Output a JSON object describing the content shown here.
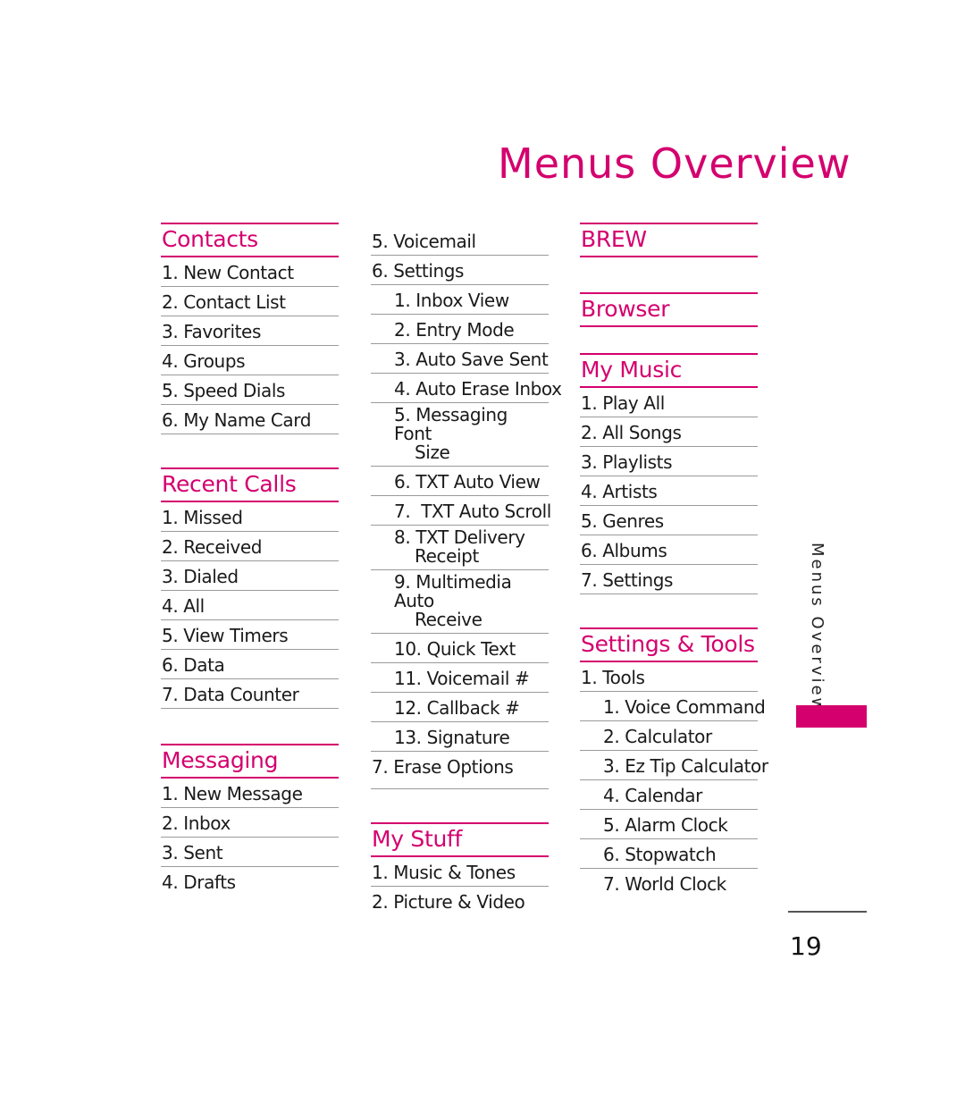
{
  "page": {
    "title": "Menus Overview",
    "side_tab_label": "Menus Overview",
    "page_number": "19",
    "accent_color": "#d4006e"
  },
  "columns": [
    {
      "sections": [
        {
          "heading": "Contacts",
          "items": [
            {
              "label": "1. New Contact"
            },
            {
              "label": "2. Contact List"
            },
            {
              "label": "3. Favorites"
            },
            {
              "label": "4. Groups"
            },
            {
              "label": "5. Speed Dials"
            },
            {
              "label": "6. My Name Card"
            }
          ]
        },
        {
          "heading": "Recent Calls",
          "items": [
            {
              "label": "1. Missed"
            },
            {
              "label": "2. Received"
            },
            {
              "label": "3. Dialed"
            },
            {
              "label": "4. All"
            },
            {
              "label": "5. View Timers"
            },
            {
              "label": "6. Data"
            },
            {
              "label": "7. Data Counter"
            }
          ]
        },
        {
          "heading": "Messaging",
          "items": [
            {
              "label": "1. New Message"
            },
            {
              "label": "2. Inbox"
            },
            {
              "label": "3. Sent"
            },
            {
              "label": "4. Drafts"
            }
          ]
        }
      ]
    },
    {
      "sections": [
        {
          "heading": null,
          "items": [
            {
              "label": "5. Voicemail"
            },
            {
              "label": "6. Settings"
            },
            {
              "label": "1. Inbox View",
              "level": 2
            },
            {
              "label": "2. Entry Mode",
              "level": 2
            },
            {
              "label": "3. Auto Save Sent",
              "level": 2
            },
            {
              "label": "4. Auto Erase Inbox",
              "level": 2
            },
            {
              "label": "5. Messaging Font",
              "cont": "Size",
              "level": 2
            },
            {
              "label": "6. TXT Auto View",
              "level": 2
            },
            {
              "label": "7.  TXT Auto Scroll",
              "level": 2
            },
            {
              "label": "8. TXT Delivery",
              "cont": "Receipt",
              "level": 2
            },
            {
              "label": "9. Multimedia Auto",
              "cont": "Receive",
              "level": 2
            },
            {
              "label": "10. Quick Text",
              "level": 2
            },
            {
              "label": "11. Voicemail #",
              "level": 2
            },
            {
              "label": "12. Callback #",
              "level": 2
            },
            {
              "label": "13. Signature",
              "level": 2
            },
            {
              "label": "7. Erase Options"
            }
          ]
        },
        {
          "heading": "My Stuff",
          "items": [
            {
              "label": "1. Music & Tones"
            },
            {
              "label": "2. Picture & Video"
            }
          ]
        }
      ]
    },
    {
      "sections": [
        {
          "heading": "BREW",
          "items": []
        },
        {
          "heading": "Browser",
          "items": []
        },
        {
          "heading": "My Music",
          "items": [
            {
              "label": "1. Play All"
            },
            {
              "label": "2. All Songs"
            },
            {
              "label": "3. Playlists"
            },
            {
              "label": "4. Artists"
            },
            {
              "label": "5. Genres"
            },
            {
              "label": "6. Albums"
            },
            {
              "label": "7. Settings"
            }
          ]
        },
        {
          "heading": "Settings & Tools",
          "items": [
            {
              "label": "1. Tools"
            },
            {
              "label": "1. Voice Command",
              "level": 2
            },
            {
              "label": "2. Calculator",
              "level": 2
            },
            {
              "label": "3. Ez Tip Calculator",
              "level": 2
            },
            {
              "label": "4. Calendar",
              "level": 2
            },
            {
              "label": "5. Alarm Clock",
              "level": 2
            },
            {
              "label": "6. Stopwatch",
              "level": 2
            },
            {
              "label": "7. World Clock",
              "level": 2
            }
          ]
        }
      ]
    }
  ]
}
